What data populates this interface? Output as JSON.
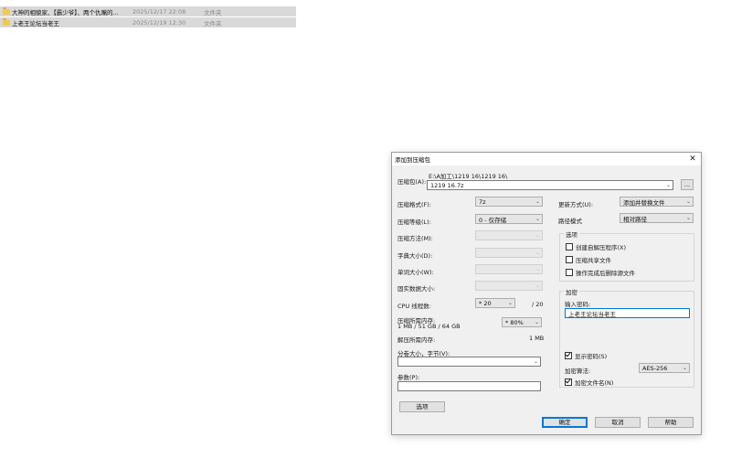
{
  "files": [
    {
      "name": "大神的相貌家、【霸少爷】、两个仇嘴的...",
      "date": "2025/12/17 22:08",
      "type": "文件夹"
    },
    {
      "name": "上老王论坛当老王",
      "date": "2025/12/19 12:30",
      "type": "文件夹"
    }
  ],
  "dialog": {
    "title": "添加到压缩包",
    "archive_label": "压缩包(A):",
    "archive_path": "E:\\A加工\\1219 16\\1219 16\\",
    "archive_name": "1219 16.7z",
    "browse_label": "...",
    "format_label": "压缩格式(F):",
    "format_value": "7z",
    "level_label": "压缩等级(L):",
    "level_value": "0 - 仅存储",
    "method_label": "压缩方法(M):",
    "dict_label": "字典大小(D):",
    "word_label": "单词大小(W):",
    "solid_label": "固实数据大小:",
    "cpu_label": "CPU 线程数:",
    "cpu_value": "* 20",
    "cpu_total": "/ 20",
    "mem_label": "压缩所需内存:",
    "mem_detail": "1 MB / 51 GB / 64 GB",
    "mem_value": "* 80%",
    "decomp_label": "解压所需内存:",
    "decomp_value": "1 MB",
    "split_label": "分卷大小，字节(V):",
    "params_label": "参数(P):",
    "options_btn": "选项",
    "update_label": "更新方式(U):",
    "update_value": "添加并替换文件",
    "pathmode_label": "路径模式",
    "pathmode_value": "相对路径",
    "options_group": "选项",
    "opt_sfx": "创建自解压程序(X)",
    "opt_shared": "压缩共享文件",
    "opt_delete": "操作完成后删除源文件",
    "encrypt_group": "加密",
    "password_label": "输入密码:",
    "password_value": "上老王论坛当老王",
    "show_password": "显示密码(S)",
    "enc_method_label": "加密算法:",
    "enc_method_value": "AES-256",
    "enc_names": "加密文件名(N)",
    "ok": "确定",
    "cancel": "取消",
    "help": "帮助"
  },
  "colors": {
    "accent": "#0078d7",
    "folder": "#f2c94c",
    "selection": "#d9d9d9"
  }
}
